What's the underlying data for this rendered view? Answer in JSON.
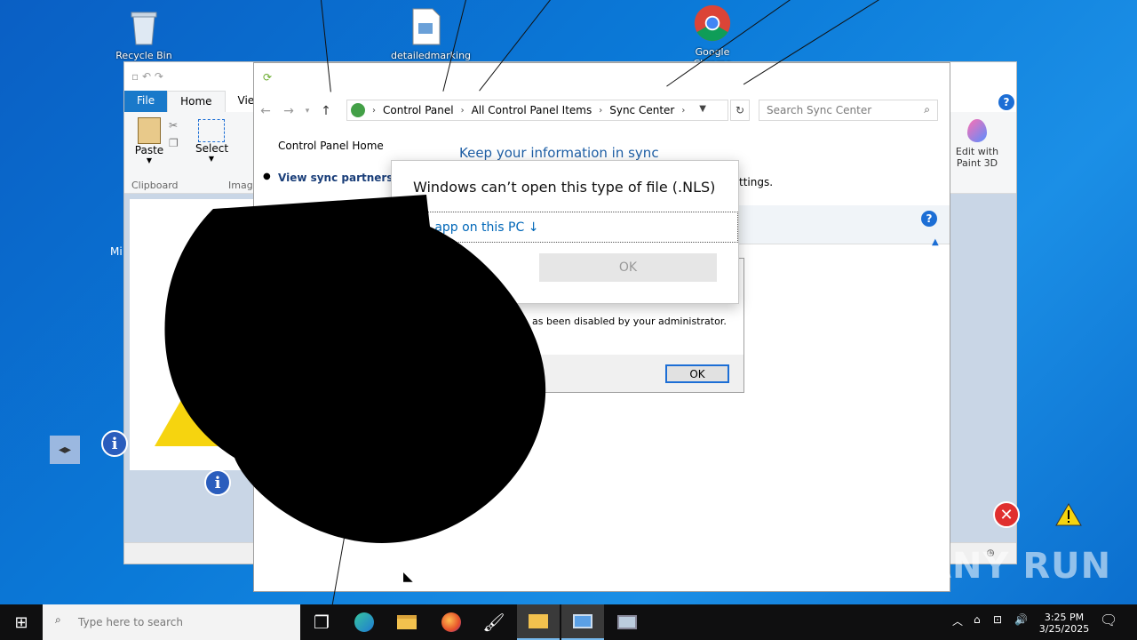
{
  "desktop": {
    "icons": [
      {
        "label": "Recycle Bin",
        "icon": "recycle-bin-icon"
      },
      {
        "label": "detailedmarking",
        "icon": "document-icon"
      },
      {
        "label": "Google Chrome",
        "icon": "chrome-icon"
      }
    ],
    "partial_label": "Mi"
  },
  "paint": {
    "tabs": [
      "File",
      "Home",
      "View"
    ],
    "ribbon": {
      "paste_label": "Paste",
      "select_label": "Select",
      "clipboard_group": "Clipboard",
      "image_group": "Image",
      "edit_paint3d_line1": "Edit with",
      "edit_paint3d_line2": "Paint 3D"
    }
  },
  "sync_center": {
    "breadcrumbs": [
      "Control Panel",
      "All Control Panel Items",
      "Sync Center"
    ],
    "search_placeholder": "Search Sync Center",
    "sidebar": {
      "home_link": "Control Panel Home",
      "view_partnerships": "View sync partnerships"
    },
    "heading": "Keep your information in sync",
    "settings_fragment": "ttings."
  },
  "admin_dialog": {
    "message_fragment": "as been disabled by your administrator.",
    "ok_label": "OK"
  },
  "open_with_dialog": {
    "title": "Windows can’t open this type of file (.NLS)",
    "look_link": "p app on this PC ↓",
    "ok_label": "OK"
  },
  "taskbar": {
    "search_placeholder": "Type here to search",
    "time": "3:25 PM",
    "date": "3/25/2025"
  },
  "watermark": "ANY RUN",
  "colors": {
    "desktop_blue": "#0b7ad8",
    "link_blue": "#0067b8",
    "heading_blue": "#1e5fa6",
    "file_tab": "#1979ca"
  }
}
